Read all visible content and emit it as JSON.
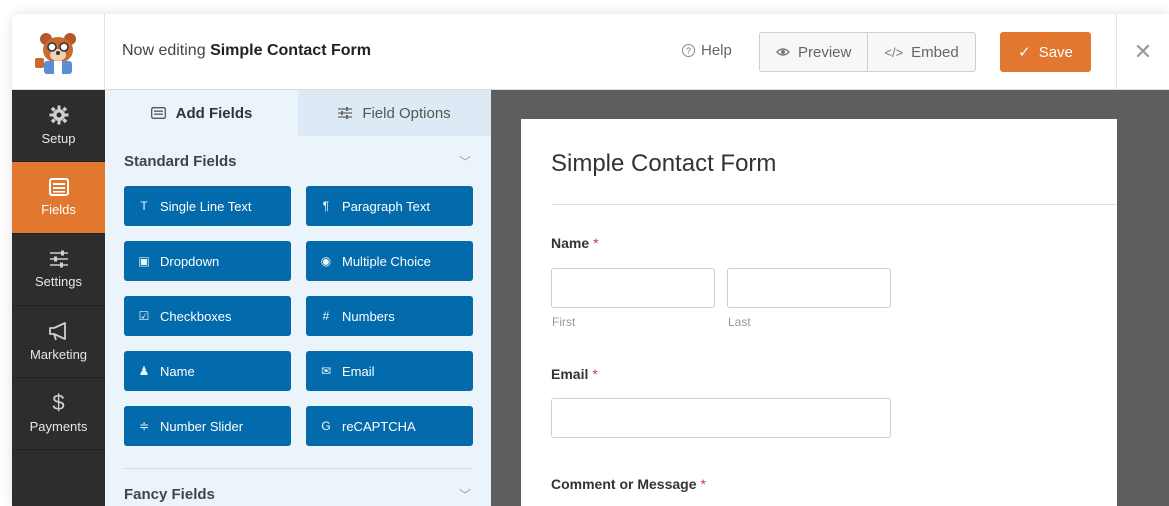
{
  "header": {
    "editing_prefix": "Now editing",
    "form_name": "Simple Contact Form",
    "help_label": "Help",
    "preview_label": "Preview",
    "embed_label": "Embed",
    "save_label": "Save",
    "close_icon": "close-icon"
  },
  "colors": {
    "accent": "#e27730",
    "field_button": "#036aab",
    "sidebar": "#2d2d2d",
    "panel": "#ebf3fb",
    "preview_bg": "#5e5e5e",
    "required": "#d63638"
  },
  "sidebar": {
    "items": [
      {
        "label": "Setup",
        "icon": "gear-icon"
      },
      {
        "label": "Fields",
        "icon": "list-icon",
        "active": true
      },
      {
        "label": "Settings",
        "icon": "sliders-icon"
      },
      {
        "label": "Marketing",
        "icon": "megaphone-icon"
      },
      {
        "label": "Payments",
        "icon": "dollar-icon"
      }
    ]
  },
  "panel": {
    "tabs": [
      {
        "label": "Add Fields",
        "icon": "list-icon",
        "active": true
      },
      {
        "label": "Field Options",
        "icon": "sliders-icon"
      }
    ],
    "standard_title": "Standard Fields",
    "fancy_title": "Fancy Fields",
    "fields": [
      {
        "label": "Single Line Text",
        "icon": "text-icon",
        "glyph": "T"
      },
      {
        "label": "Paragraph Text",
        "icon": "paragraph-icon",
        "glyph": "¶"
      },
      {
        "label": "Dropdown",
        "icon": "dropdown-icon",
        "glyph": "▣"
      },
      {
        "label": "Multiple Choice",
        "icon": "radio-icon",
        "glyph": "◉"
      },
      {
        "label": "Checkboxes",
        "icon": "checkbox-icon",
        "glyph": "☑"
      },
      {
        "label": "Numbers",
        "icon": "hash-icon",
        "glyph": "#"
      },
      {
        "label": "Name",
        "icon": "user-icon",
        "glyph": "♟"
      },
      {
        "label": "Email",
        "icon": "envelope-icon",
        "glyph": "✉"
      },
      {
        "label": "Number Slider",
        "icon": "slider-icon",
        "glyph": "≑"
      },
      {
        "label": "reCAPTCHA",
        "icon": "google-icon",
        "glyph": "G"
      }
    ]
  },
  "form": {
    "title": "Simple Contact Form",
    "name_label": "Name",
    "first_sub": "First",
    "last_sub": "Last",
    "email_label": "Email",
    "comment_label": "Comment or Message",
    "required_mark": "*"
  }
}
